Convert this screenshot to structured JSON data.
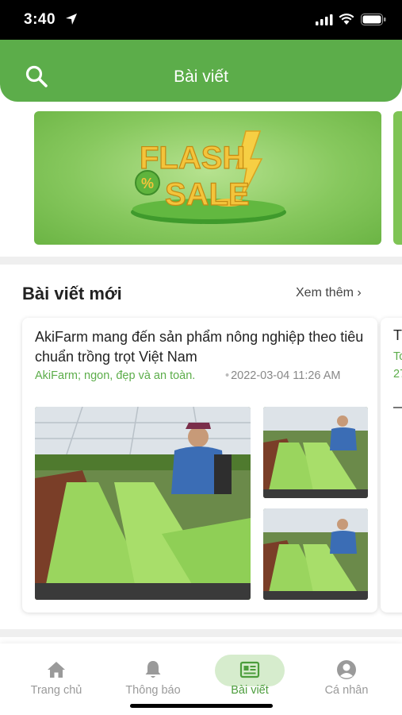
{
  "status_bar": {
    "time": "3:40",
    "icons": [
      "location-arrow-icon",
      "cellular-signal-icon",
      "wifi-icon",
      "battery-icon"
    ]
  },
  "header": {
    "title": "Bài viết",
    "search_icon": "search-icon"
  },
  "banner": {
    "text_line1": "FLASH",
    "text_line2": "SALE",
    "badge_text": "%",
    "colors": {
      "bg": "#87c85e",
      "accent": "#f2c23a"
    }
  },
  "section": {
    "title": "Bài viết mới",
    "see_more": "Xem thêm ›"
  },
  "articles": [
    {
      "title": "AkiFarm mang đến sản phẩm nông nghiệp theo tiêu chuẩn trồng trọt Việt Nam",
      "tags": "AkiFarm; ngon, đẹp và an toàn.",
      "date": "2022-03-04 11:26 AM"
    },
    {
      "title": "T",
      "tags": "Tc 27"
    }
  ],
  "bottom_nav": [
    {
      "label": "Trang chủ",
      "icon": "home-icon",
      "active": false
    },
    {
      "label": "Thông báo",
      "icon": "bell-icon",
      "active": false
    },
    {
      "label": "Bài viết",
      "icon": "article-icon",
      "active": true
    },
    {
      "label": "Cá nhân",
      "icon": "user-icon",
      "active": false
    }
  ],
  "colors": {
    "primary_green": "#5cad4a",
    "active_pill": "#d6eccd",
    "tag_green": "#5cad4a",
    "muted_text": "#9a9a9a"
  }
}
